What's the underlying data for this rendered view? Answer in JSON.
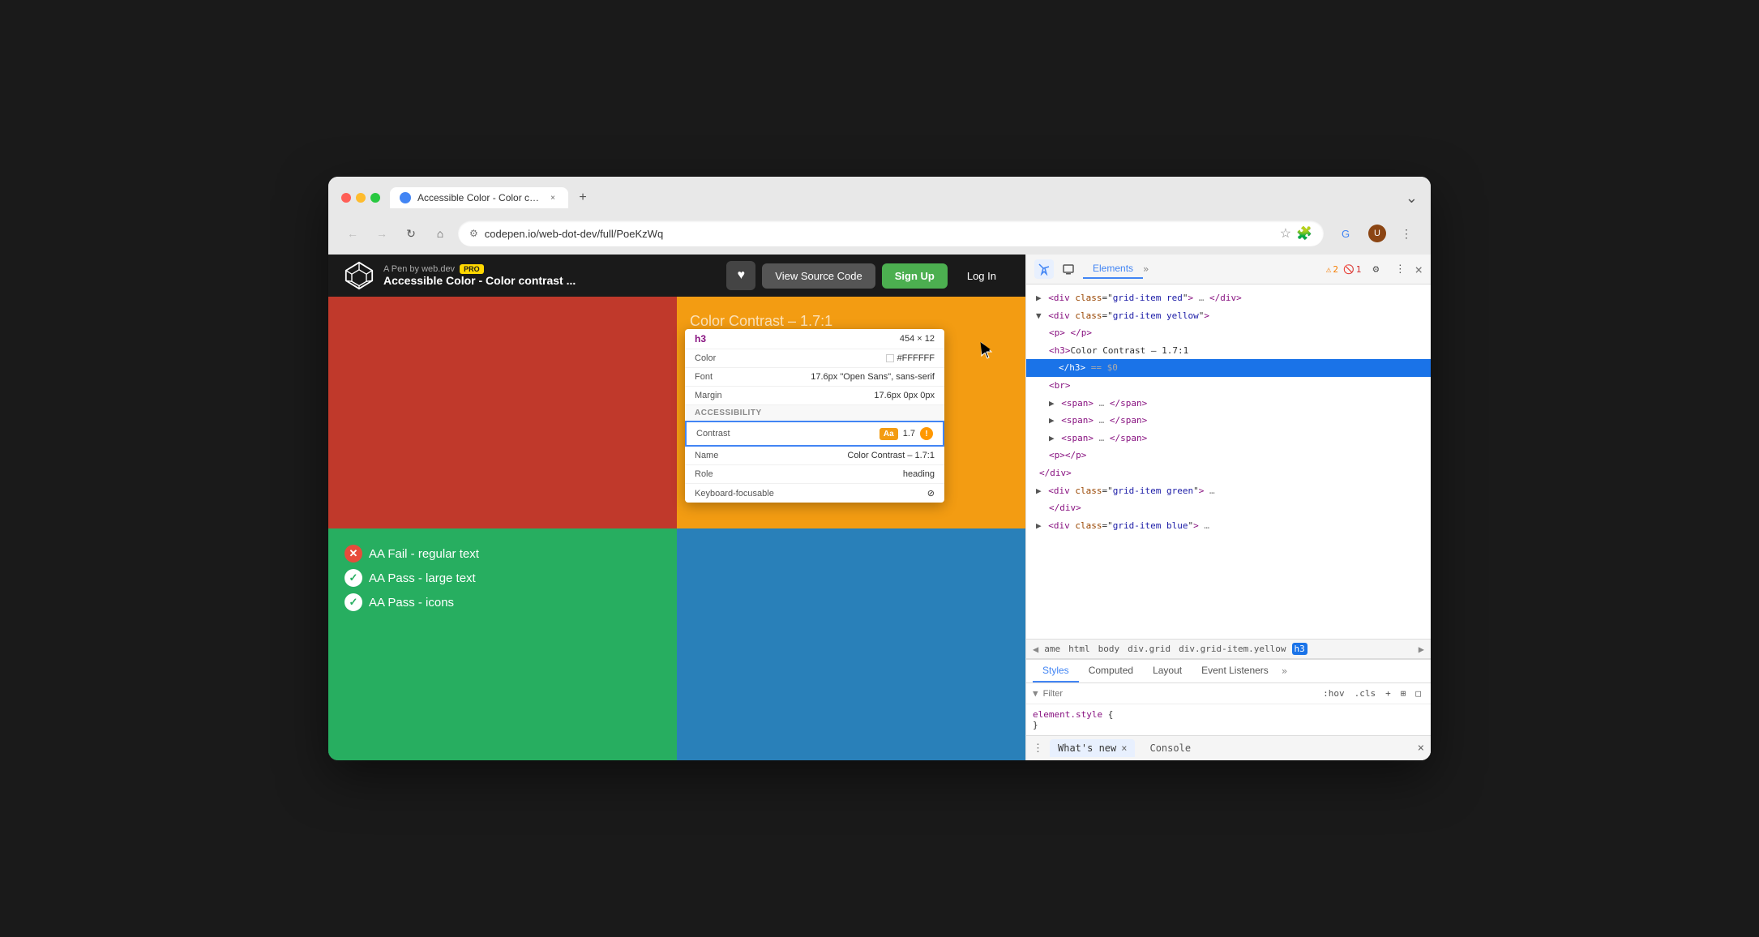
{
  "browser": {
    "tab_title": "Accessible Color - Color cont…",
    "tab_close": "×",
    "tab_add": "+",
    "url": "codepen.io/web-dot-dev/full/PoeKzWq",
    "nav_back": "←",
    "nav_forward": "→",
    "nav_refresh": "↻",
    "nav_home": "⌂",
    "address_icon": "⚙",
    "tab_menu_icon": "⌄"
  },
  "pen_header": {
    "author": "A Pen by web.dev",
    "pro_badge": "PRO",
    "title": "Accessible Color - Color contrast ...",
    "heart_icon": "♥",
    "view_source_btn": "View Source Code",
    "signup_btn": "Sign Up",
    "login_btn": "Log In"
  },
  "preview": {
    "heading": "Color Contrast – 1.7:1",
    "fail_items": [
      {
        "icon": "✕",
        "text": "AA Fail - regular text",
        "type": "fail"
      },
      {
        "icon": "✓",
        "text": "AA Pass - large text",
        "type": "pass"
      },
      {
        "icon": "✓",
        "text": "AA Pass - icons",
        "type": "pass"
      }
    ]
  },
  "tooltip": {
    "element_label": "h3",
    "element_size": "454 × 12",
    "color_label": "Color",
    "color_value": "#FFFFFF",
    "font_label": "Font",
    "font_value": "17.6px \"Open Sans\", sans-serif",
    "margin_label": "Margin",
    "margin_value": "17.6px 0px 0px",
    "accessibility_header": "ACCESSIBILITY",
    "contrast_label": "Contrast",
    "aa_badge": "Aa",
    "contrast_value": "1.7",
    "info_icon": "!",
    "name_label": "Name",
    "name_value": "Color Contrast – 1.7:1",
    "role_label": "Role",
    "role_value": "heading",
    "keyboard_label": "Keyboard-focusable",
    "keyboard_value": "⊘"
  },
  "devtools": {
    "toolbar": {
      "pointer_icon": "⇱",
      "device_icon": "□",
      "elements_tab": "Elements",
      "chevron": "»",
      "warn_count": "2",
      "err_count": "1",
      "gear_icon": "⚙",
      "more_icon": "⋮",
      "close_icon": "×"
    },
    "tree": {
      "dots": "…",
      "lines": [
        {
          "indent": 0,
          "content": "▶ <div class=\"grid-item red\"> … </div>",
          "type": "collapsed",
          "selected": false
        },
        {
          "indent": 0,
          "content": "▼ <div class=\"grid-item yellow\">",
          "type": "open",
          "selected": false
        },
        {
          "indent": 1,
          "content": "<p> </p>",
          "type": "leaf",
          "selected": false
        },
        {
          "indent": 1,
          "content": "<h3>Color Contrast – 1.7:1",
          "type": "open-h3",
          "selected": false
        },
        {
          "indent": 2,
          "content": "</h3> == $0",
          "type": "close",
          "selected": true
        },
        {
          "indent": 1,
          "content": "<br>",
          "type": "leaf",
          "selected": false
        },
        {
          "indent": 1,
          "content": "▶ <span> … </span>",
          "type": "collapsed",
          "selected": false
        },
        {
          "indent": 1,
          "content": "▶ <span> … </span>",
          "type": "collapsed",
          "selected": false
        },
        {
          "indent": 1,
          "content": "▶ <span> … </span>",
          "type": "collapsed",
          "selected": false
        },
        {
          "indent": 1,
          "content": "<p></p>",
          "type": "leaf",
          "selected": false
        },
        {
          "indent": 0,
          "content": "</div>",
          "type": "close",
          "selected": false
        },
        {
          "indent": 0,
          "content": "▶ <div class=\"grid-item green\"> …",
          "type": "collapsed",
          "selected": false
        },
        {
          "indent": 1,
          "content": "</div>",
          "type": "close",
          "selected": false
        },
        {
          "indent": 0,
          "content": "▶ <div class=\"grid-item blue\"> …",
          "type": "collapsed",
          "selected": false
        }
      ]
    },
    "breadcrumb": {
      "items": [
        "ame",
        "html",
        "body",
        "div.grid",
        "div.grid-item.yellow",
        "h3"
      ]
    },
    "styles": {
      "tabs": [
        "Styles",
        "Computed",
        "Layout",
        "Event Listeners"
      ],
      "more": "»",
      "filter_placeholder": "Filter",
      "filter_actions": [
        ":hov",
        ".cls",
        "+",
        "⊞",
        "□"
      ],
      "rule": "element.style {",
      "rule_close": "}"
    },
    "bottom": {
      "menu_icon": "⋮",
      "whats_new_label": "What's new",
      "close_wn": "×",
      "console_label": "Console",
      "close_btn": "×"
    }
  },
  "colors": {
    "accent_blue": "#4285f4",
    "yellow_bg": "#f39c12",
    "green_bg": "#27ae60",
    "red_bg": "#c0392b",
    "blue_bg": "#2980b9",
    "contrast_badge": "#f39c12",
    "pro_badge": "#ffd700"
  }
}
